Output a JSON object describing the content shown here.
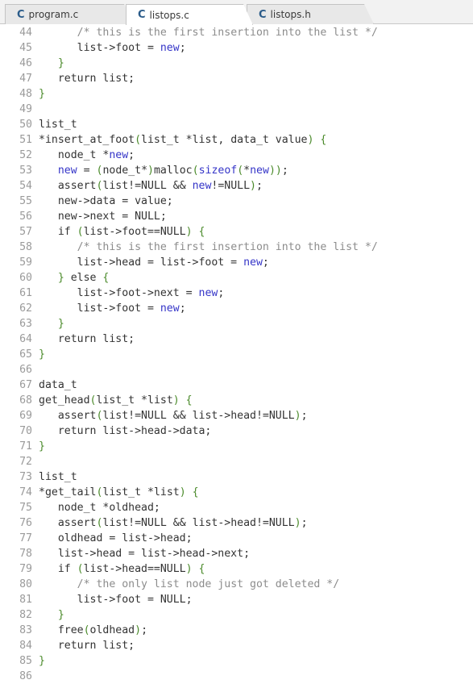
{
  "tabs": [
    {
      "label": "program.c",
      "icon": "C",
      "active": false
    },
    {
      "label": "listops.c",
      "icon": "C",
      "active": true
    },
    {
      "label": "listops.h",
      "icon": "C",
      "active": false
    }
  ],
  "lines": [
    {
      "n": "44",
      "t": "      /* this is the first insertion into the list */"
    },
    {
      "n": "45",
      "t": "      list->foot = new;"
    },
    {
      "n": "46",
      "t": "   }"
    },
    {
      "n": "47",
      "t": "   return list;"
    },
    {
      "n": "48",
      "t": "}"
    },
    {
      "n": "49",
      "t": ""
    },
    {
      "n": "50",
      "t": "list_t"
    },
    {
      "n": "51",
      "t": "*insert_at_foot(list_t *list, data_t value) {"
    },
    {
      "n": "52",
      "t": "   node_t *new;"
    },
    {
      "n": "53",
      "t": "   new = (node_t*)malloc(sizeof(*new));"
    },
    {
      "n": "54",
      "t": "   assert(list!=NULL && new!=NULL);"
    },
    {
      "n": "55",
      "t": "   new->data = value;"
    },
    {
      "n": "56",
      "t": "   new->next = NULL;"
    },
    {
      "n": "57",
      "t": "   if (list->foot==NULL) {"
    },
    {
      "n": "58",
      "t": "      /* this is the first insertion into the list */"
    },
    {
      "n": "59",
      "t": "      list->head = list->foot = new;"
    },
    {
      "n": "60",
      "t": "   } else {"
    },
    {
      "n": "61",
      "t": "      list->foot->next = new;"
    },
    {
      "n": "62",
      "t": "      list->foot = new;"
    },
    {
      "n": "63",
      "t": "   }"
    },
    {
      "n": "64",
      "t": "   return list;"
    },
    {
      "n": "65",
      "t": "}"
    },
    {
      "n": "66",
      "t": ""
    },
    {
      "n": "67",
      "t": "data_t"
    },
    {
      "n": "68",
      "t": "get_head(list_t *list) {"
    },
    {
      "n": "69",
      "t": "   assert(list!=NULL && list->head!=NULL);"
    },
    {
      "n": "70",
      "t": "   return list->head->data;"
    },
    {
      "n": "71",
      "t": "}"
    },
    {
      "n": "72",
      "t": ""
    },
    {
      "n": "73",
      "t": "list_t"
    },
    {
      "n": "74",
      "t": "*get_tail(list_t *list) {"
    },
    {
      "n": "75",
      "t": "   node_t *oldhead;"
    },
    {
      "n": "76",
      "t": "   assert(list!=NULL && list->head!=NULL);"
    },
    {
      "n": "77",
      "t": "   oldhead = list->head;"
    },
    {
      "n": "78",
      "t": "   list->head = list->head->next;"
    },
    {
      "n": "79",
      "t": "   if (list->head==NULL) {"
    },
    {
      "n": "80",
      "t": "      /* the only list node just got deleted */"
    },
    {
      "n": "81",
      "t": "      list->foot = NULL;"
    },
    {
      "n": "82",
      "t": "   }"
    },
    {
      "n": "83",
      "t": "   free(oldhead);"
    },
    {
      "n": "84",
      "t": "   return list;"
    },
    {
      "n": "85",
      "t": "}"
    },
    {
      "n": "86",
      "t": ""
    }
  ]
}
